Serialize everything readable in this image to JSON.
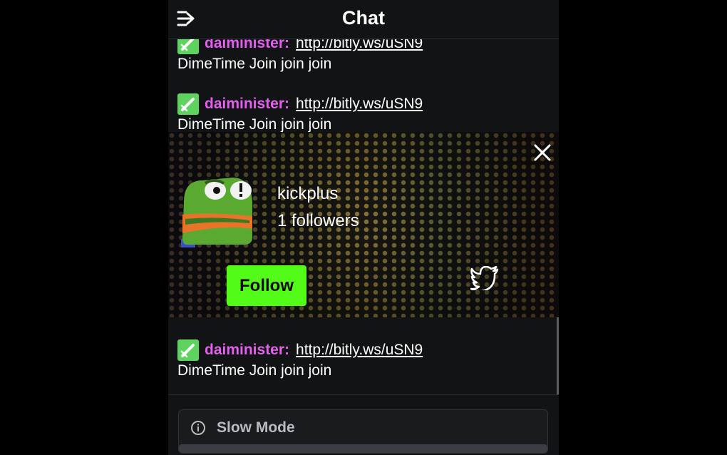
{
  "header": {
    "title": "Chat",
    "collapse_icon": "collapse-arrow-icon"
  },
  "messages": [
    {
      "badge_icon": "sword-badge-icon",
      "username": "daiminister",
      "colon": ":",
      "link": "http://bitly.ws/uSN9",
      "text": "DimeTime Join join join"
    },
    {
      "badge_icon": "sword-badge-icon",
      "username": "daiminister",
      "colon": ":",
      "link": "http://bitly.ws/uSN9",
      "text": "DimeTime Join join join"
    },
    {
      "badge_icon": "sword-badge-icon",
      "username": "daiminister",
      "colon": ":",
      "link": "http://bitly.ws/uSN9",
      "text": "DimeTime Join join join"
    }
  ],
  "user_card": {
    "username": "kickplus",
    "followers": "1 followers",
    "follow_label": "Follow",
    "avatar": "frog-avatar",
    "close_icon": "close-icon",
    "twitter_icon": "twitter-icon"
  },
  "slow_mode": {
    "label": "Slow Mode",
    "icon": "info-icon"
  },
  "colors": {
    "accent": "#53fc18",
    "username": "#e45ef0",
    "badge": "#5fd35f",
    "background": "#121314"
  }
}
